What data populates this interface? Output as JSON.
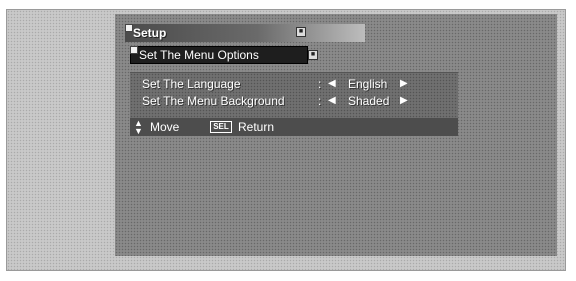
{
  "menu": {
    "title": "Setup",
    "submenu": "Set The Menu Options",
    "options": [
      {
        "label": "Set The Language",
        "separator": ":",
        "value": "English"
      },
      {
        "label": "Set The Menu Background",
        "separator": ":",
        "value": "Shaded"
      }
    ]
  },
  "help": {
    "move_label": "Move",
    "sel_badge": "SEL",
    "return_label": "Return"
  },
  "icons": {
    "remote": "remote-control-icon",
    "left_arrow": "left-arrow-icon",
    "right_arrow": "right-arrow-icon",
    "updown": "up-down-arrow-icon"
  }
}
